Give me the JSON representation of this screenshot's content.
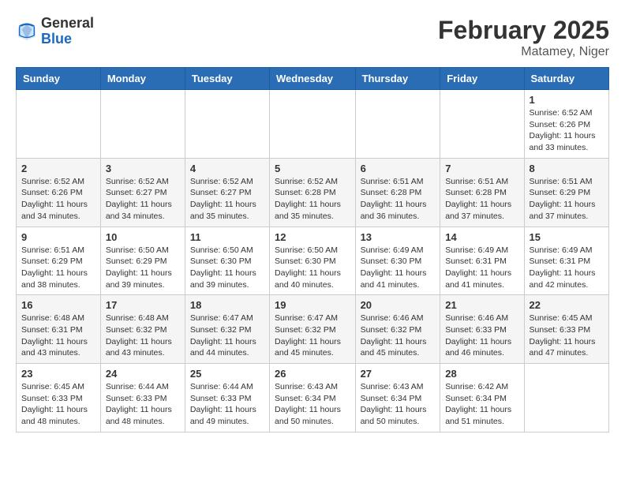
{
  "header": {
    "logo_general": "General",
    "logo_blue": "Blue",
    "month_year": "February 2025",
    "location": "Matamey, Niger"
  },
  "weekdays": [
    "Sunday",
    "Monday",
    "Tuesday",
    "Wednesday",
    "Thursday",
    "Friday",
    "Saturday"
  ],
  "weeks": [
    [
      {
        "day": "",
        "info": ""
      },
      {
        "day": "",
        "info": ""
      },
      {
        "day": "",
        "info": ""
      },
      {
        "day": "",
        "info": ""
      },
      {
        "day": "",
        "info": ""
      },
      {
        "day": "",
        "info": ""
      },
      {
        "day": "1",
        "info": "Sunrise: 6:52 AM\nSunset: 6:26 PM\nDaylight: 11 hours and 33 minutes."
      }
    ],
    [
      {
        "day": "2",
        "info": "Sunrise: 6:52 AM\nSunset: 6:26 PM\nDaylight: 11 hours and 34 minutes."
      },
      {
        "day": "3",
        "info": "Sunrise: 6:52 AM\nSunset: 6:27 PM\nDaylight: 11 hours and 34 minutes."
      },
      {
        "day": "4",
        "info": "Sunrise: 6:52 AM\nSunset: 6:27 PM\nDaylight: 11 hours and 35 minutes."
      },
      {
        "day": "5",
        "info": "Sunrise: 6:52 AM\nSunset: 6:28 PM\nDaylight: 11 hours and 35 minutes."
      },
      {
        "day": "6",
        "info": "Sunrise: 6:51 AM\nSunset: 6:28 PM\nDaylight: 11 hours and 36 minutes."
      },
      {
        "day": "7",
        "info": "Sunrise: 6:51 AM\nSunset: 6:28 PM\nDaylight: 11 hours and 37 minutes."
      },
      {
        "day": "8",
        "info": "Sunrise: 6:51 AM\nSunset: 6:29 PM\nDaylight: 11 hours and 37 minutes."
      }
    ],
    [
      {
        "day": "9",
        "info": "Sunrise: 6:51 AM\nSunset: 6:29 PM\nDaylight: 11 hours and 38 minutes."
      },
      {
        "day": "10",
        "info": "Sunrise: 6:50 AM\nSunset: 6:29 PM\nDaylight: 11 hours and 39 minutes."
      },
      {
        "day": "11",
        "info": "Sunrise: 6:50 AM\nSunset: 6:30 PM\nDaylight: 11 hours and 39 minutes."
      },
      {
        "day": "12",
        "info": "Sunrise: 6:50 AM\nSunset: 6:30 PM\nDaylight: 11 hours and 40 minutes."
      },
      {
        "day": "13",
        "info": "Sunrise: 6:49 AM\nSunset: 6:30 PM\nDaylight: 11 hours and 41 minutes."
      },
      {
        "day": "14",
        "info": "Sunrise: 6:49 AM\nSunset: 6:31 PM\nDaylight: 11 hours and 41 minutes."
      },
      {
        "day": "15",
        "info": "Sunrise: 6:49 AM\nSunset: 6:31 PM\nDaylight: 11 hours and 42 minutes."
      }
    ],
    [
      {
        "day": "16",
        "info": "Sunrise: 6:48 AM\nSunset: 6:31 PM\nDaylight: 11 hours and 43 minutes."
      },
      {
        "day": "17",
        "info": "Sunrise: 6:48 AM\nSunset: 6:32 PM\nDaylight: 11 hours and 43 minutes."
      },
      {
        "day": "18",
        "info": "Sunrise: 6:47 AM\nSunset: 6:32 PM\nDaylight: 11 hours and 44 minutes."
      },
      {
        "day": "19",
        "info": "Sunrise: 6:47 AM\nSunset: 6:32 PM\nDaylight: 11 hours and 45 minutes."
      },
      {
        "day": "20",
        "info": "Sunrise: 6:46 AM\nSunset: 6:32 PM\nDaylight: 11 hours and 45 minutes."
      },
      {
        "day": "21",
        "info": "Sunrise: 6:46 AM\nSunset: 6:33 PM\nDaylight: 11 hours and 46 minutes."
      },
      {
        "day": "22",
        "info": "Sunrise: 6:45 AM\nSunset: 6:33 PM\nDaylight: 11 hours and 47 minutes."
      }
    ],
    [
      {
        "day": "23",
        "info": "Sunrise: 6:45 AM\nSunset: 6:33 PM\nDaylight: 11 hours and 48 minutes."
      },
      {
        "day": "24",
        "info": "Sunrise: 6:44 AM\nSunset: 6:33 PM\nDaylight: 11 hours and 48 minutes."
      },
      {
        "day": "25",
        "info": "Sunrise: 6:44 AM\nSunset: 6:33 PM\nDaylight: 11 hours and 49 minutes."
      },
      {
        "day": "26",
        "info": "Sunrise: 6:43 AM\nSunset: 6:34 PM\nDaylight: 11 hours and 50 minutes."
      },
      {
        "day": "27",
        "info": "Sunrise: 6:43 AM\nSunset: 6:34 PM\nDaylight: 11 hours and 50 minutes."
      },
      {
        "day": "28",
        "info": "Sunrise: 6:42 AM\nSunset: 6:34 PM\nDaylight: 11 hours and 51 minutes."
      },
      {
        "day": "",
        "info": ""
      }
    ]
  ]
}
